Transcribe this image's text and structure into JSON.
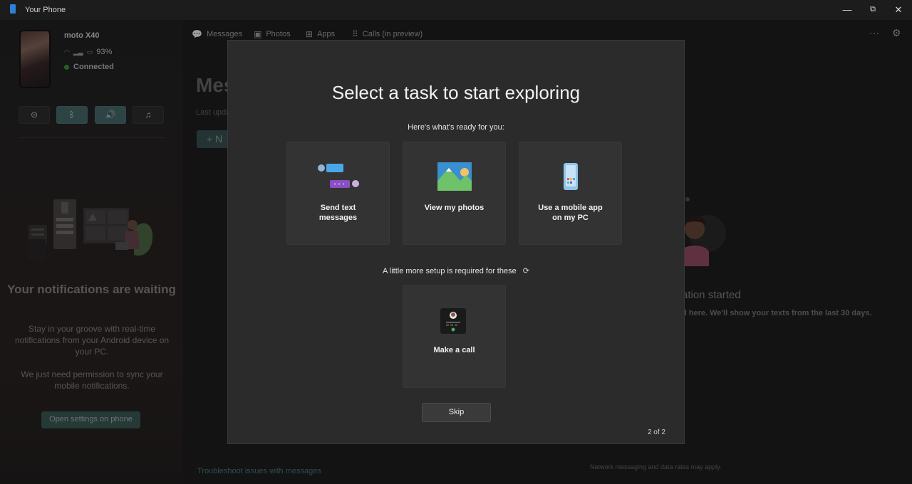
{
  "window": {
    "title": "Your Phone",
    "minimize": "—",
    "maximize": "⧉",
    "close": "✕"
  },
  "phone": {
    "name": "moto X40",
    "battery": "93%",
    "status": "Connected"
  },
  "toggles": [
    {
      "name": "do-not-disturb",
      "icon": "⊝"
    },
    {
      "name": "bluetooth",
      "icon": "ᛒ"
    },
    {
      "name": "sound",
      "icon": "🔊"
    },
    {
      "name": "music",
      "icon": "♫"
    }
  ],
  "notifications": {
    "title": "Your notifications are waiting",
    "body": "Stay in your groove with real-time notifications from your Android device on your PC.",
    "body2": "We just need permission to sync your mobile notifications.",
    "button": "Open settings on phone"
  },
  "nav": {
    "messages": "Messages",
    "photos": "Photos",
    "apps": "Apps",
    "calls": "Calls (in preview)"
  },
  "messages_view": {
    "heading": "Mes",
    "last_updated": "Last upda",
    "new_button": "+   N",
    "conversation_title": "ation started",
    "conversation_body": "d here. We'll show your texts from the last 30 days.",
    "troubleshoot": "Troubleshoot issues with messages",
    "rates": "Network messaging and data rates may apply."
  },
  "dialog": {
    "title": "Select a task to start exploring",
    "ready_heading": "Here's what's ready for you:",
    "cards": [
      {
        "label_line1": "Send text",
        "label_line2": "messages"
      },
      {
        "label_line1": "View my photos",
        "label_line2": ""
      },
      {
        "label_line1": "Use a mobile app",
        "label_line2": "on my PC"
      }
    ],
    "setup_heading": "A little more setup is required for these",
    "setup_card": {
      "label": "Make a call"
    },
    "skip": "Skip",
    "pager": "2 of 2"
  },
  "colors": {
    "accent": "#4a6e70",
    "connected_dot": "#3c9b3c",
    "link": "#4c7f84",
    "dialog_bg": "#2b2b2b",
    "card_bg": "#333333"
  }
}
